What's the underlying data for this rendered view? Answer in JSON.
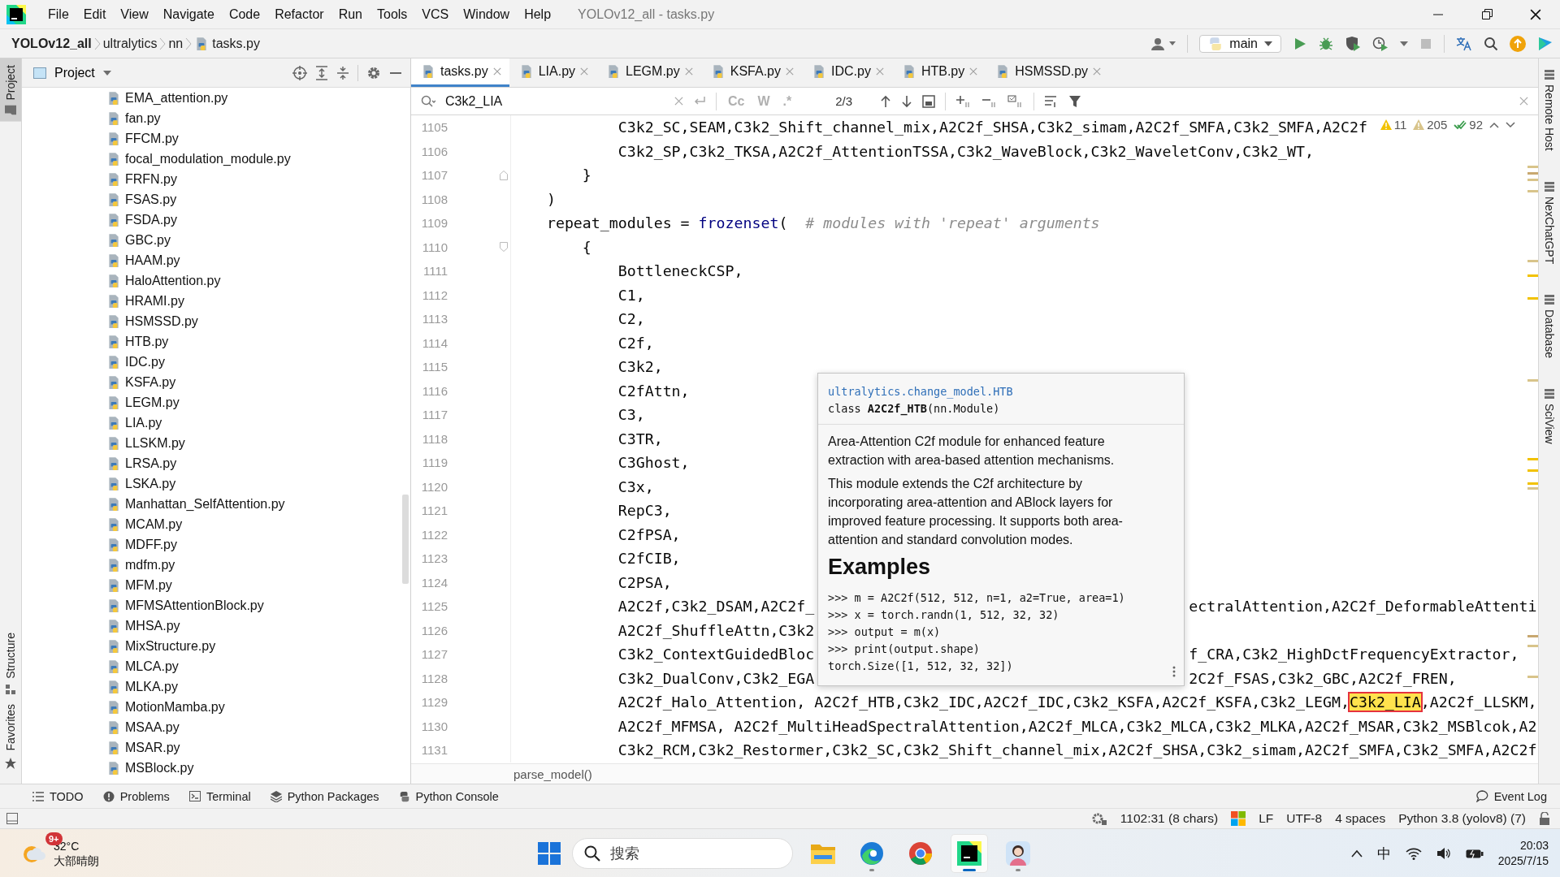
{
  "window": {
    "title": "YOLOv12_all - tasks.py"
  },
  "menu": [
    "File",
    "Edit",
    "View",
    "Navigate",
    "Code",
    "Refactor",
    "Run",
    "Tools",
    "VCS",
    "Window",
    "Help"
  ],
  "breadcrumb": [
    {
      "label": "YOLOv12_all",
      "kind": "project"
    },
    {
      "label": "ultralytics",
      "kind": "folder"
    },
    {
      "label": "nn",
      "kind": "folder"
    },
    {
      "label": "tasks.py",
      "kind": "file"
    }
  ],
  "toolbar": {
    "run_config": "main"
  },
  "left_tool_windows": [
    {
      "label": "Project",
      "selected": true
    },
    {
      "label": "Structure",
      "selected": false
    },
    {
      "label": "Favorites",
      "selected": false
    }
  ],
  "right_tool_windows": [
    "Remote Host",
    "NexChatGPT",
    "Database",
    "SciView"
  ],
  "project_panel": {
    "title": "Project",
    "files": [
      "EMA_attention.py",
      "fan.py",
      "FFCM.py",
      "focal_modulation_module.py",
      "FRFN.py",
      "FSAS.py",
      "FSDA.py",
      "GBC.py",
      "HAAM.py",
      "HaloAttention.py",
      "HRAMI.py",
      "HSMSSD.py",
      "HTB.py",
      "IDC.py",
      "KSFA.py",
      "LEGM.py",
      "LIA.py",
      "LLSKM.py",
      "LRSA.py",
      "LSKA.py",
      "Manhattan_SelfAttention.py",
      "MCAM.py",
      "MDFF.py",
      "mdfm.py",
      "MFM.py",
      "MFMSAttentionBlock.py",
      "MHSA.py",
      "MixStructure.py",
      "MLCA.py",
      "MLKA.py",
      "MotionMamba.py",
      "MSAA.py",
      "MSAR.py",
      "MSBlock.py"
    ]
  },
  "tabs": [
    {
      "label": "tasks.py",
      "selected": true
    },
    {
      "label": "LIA.py",
      "selected": false
    },
    {
      "label": "LEGM.py",
      "selected": false
    },
    {
      "label": "KSFA.py",
      "selected": false
    },
    {
      "label": "IDC.py",
      "selected": false
    },
    {
      "label": "HTB.py",
      "selected": false
    },
    {
      "label": "HSMSSD.py",
      "selected": false
    }
  ],
  "find_bar": {
    "value": "C3k2_LIA",
    "options": [
      {
        "label": "Cc",
        "on": false
      },
      {
        "label": "W",
        "on": false
      },
      {
        "label": ".*",
        "on": false
      }
    ],
    "counter": "2/3"
  },
  "inspections": {
    "warnings": "11",
    "weak_warnings": "205",
    "typos": "92"
  },
  "code_lines": [
    {
      "number": "1105",
      "segments": [
        {
          "kind": "code",
          "text": "            C3k2_SC,SEAM,C3k2_Shift_channel_mix,A2C2f_SHSA,C3k2_simam,A2C2f_SMFA,C3k2_SMFA,A2C2f"
        }
      ]
    },
    {
      "number": "1106",
      "segments": [
        {
          "kind": "code",
          "text": "            C3k2_SP,C3k2_TKSA,A2C2f_AttentionTSSA,C3k2_WaveBlock,C3k2_WaveletConv,C3k2_WT,"
        }
      ]
    },
    {
      "number": "1107",
      "fold_close": true,
      "segments": [
        {
          "kind": "code",
          "text": "        }"
        }
      ]
    },
    {
      "number": "1108",
      "segments": [
        {
          "kind": "code",
          "text": "    )"
        }
      ]
    },
    {
      "number": "1109",
      "segments": [
        {
          "kind": "code",
          "text": "    repeat_modules = "
        },
        {
          "kind": "builtin",
          "text": "frozenset"
        },
        {
          "kind": "code",
          "text": "(  "
        },
        {
          "kind": "comment",
          "text": "# modules with 'repeat' arguments"
        }
      ]
    },
    {
      "number": "1110",
      "fold_open": true,
      "segments": [
        {
          "kind": "code",
          "text": "        {"
        }
      ]
    },
    {
      "number": "1111",
      "segments": [
        {
          "kind": "code",
          "text": "            BottleneckCSP,"
        }
      ]
    },
    {
      "number": "1112",
      "segments": [
        {
          "kind": "code",
          "text": "            C1,"
        }
      ]
    },
    {
      "number": "1113",
      "segments": [
        {
          "kind": "code",
          "text": "            C2,"
        }
      ]
    },
    {
      "number": "1114",
      "segments": [
        {
          "kind": "code",
          "text": "            C2f,"
        }
      ]
    },
    {
      "number": "1115",
      "segments": [
        {
          "kind": "code",
          "text": "            C3k2,"
        }
      ]
    },
    {
      "number": "1116",
      "segments": [
        {
          "kind": "code",
          "text": "            C2fAttn,"
        }
      ]
    },
    {
      "number": "1117",
      "segments": [
        {
          "kind": "code",
          "text": "            C3,"
        }
      ]
    },
    {
      "number": "1118",
      "segments": [
        {
          "kind": "code",
          "text": "            C3TR,"
        }
      ]
    },
    {
      "number": "1119",
      "segments": [
        {
          "kind": "code",
          "text": "            C3Ghost,"
        }
      ]
    },
    {
      "number": "1120",
      "segments": [
        {
          "kind": "code",
          "text": "            C3x,"
        }
      ]
    },
    {
      "number": "1121",
      "segments": [
        {
          "kind": "code",
          "text": "            RepC3,"
        }
      ]
    },
    {
      "number": "1122",
      "segments": [
        {
          "kind": "code",
          "text": "            C2fPSA,"
        }
      ]
    },
    {
      "number": "1123",
      "segments": [
        {
          "kind": "code",
          "text": "            C2fCIB,"
        }
      ]
    },
    {
      "number": "1124",
      "segments": [
        {
          "kind": "code",
          "text": "            C2PSA,"
        }
      ]
    },
    {
      "number": "1125",
      "segments": [
        {
          "kind": "code",
          "text": "            A2C2f,C3k2_DSAM,A2C2f_"
        }
      ],
      "after_popup": "ectralAttention,A2C2f_DeformableAttenti"
    },
    {
      "number": "1126",
      "segments": [
        {
          "kind": "code",
          "text": "            A2C2f_ShuffleAttn,C3k2"
        }
      ]
    },
    {
      "number": "1127",
      "segments": [
        {
          "kind": "code",
          "text": "            C3k2_ContextGuidedBloc"
        }
      ],
      "after_popup": "f_CRA,C3k2_HighDctFrequencyExtractor,"
    },
    {
      "number": "1128",
      "segments": [
        {
          "kind": "code",
          "text": "            C3k2_DualConv,C3k2_EGA"
        }
      ],
      "after_popup": "2C2f_FSAS,C3k2_GBC,A2C2f_FREN,"
    },
    {
      "number": "1129",
      "segments": [
        {
          "kind": "code",
          "text": "            A2C2f_Halo_Attention, A2C2f_HTB,C3k2_IDC,A2C2f_IDC,C3k2_KSFA,A2C2f_KSFA,C3k2_LEGM,"
        },
        {
          "kind": "current_match",
          "text": "C3k2_LIA"
        },
        {
          "kind": "code",
          "text": ",A2C2f_LLSKM,"
        }
      ]
    },
    {
      "number": "1130",
      "segments": [
        {
          "kind": "code",
          "text": "            A2C2f_MFMSA, A2C2f_MultiHeadSpectralAttention,A2C2f_MLCA,C3k2_MLCA,C3k2_MLKA,A2C2f_MSAR,C3k2_MSBlcok,A2"
        }
      ]
    },
    {
      "number": "1131",
      "segments": [
        {
          "kind": "code",
          "text": "            C3k2_RCM,C3k2_Restormer,C3k2_SC,C3k2_Shift_channel_mix,A2C2f_SHSA,C3k2_simam,A2C2f_SMFA,C3k2_SMFA,A2C2f"
        }
      ]
    }
  ],
  "doc_popup": {
    "reference": "ultralytics.change_model.HTB",
    "signature": "class **A2C2f_HTB**(nn.Module)",
    "paragraphs": [
      "Area-Attention C2f module for enhanced feature extraction with area-based attention mechanisms.",
      "This module extends the C2f architecture by incorporating area-attention and ABlock layers for improved feature processing. It supports both area-attention and standard convolution modes."
    ],
    "heading": "Examples",
    "example": [
      ">>> m = A2C2f(512, 512, n=1, a2=True, area=1)",
      ">>> x = torch.randn(1, 512, 32, 32)",
      ">>> output = m(x)",
      ">>> print(output.shape)",
      "torch.Size([1, 512, 32, 32])"
    ]
  },
  "editor_breadcrumb": "parse_model()",
  "bottom_tools": [
    {
      "label": "TODO",
      "kind": "todo"
    },
    {
      "label": "Problems",
      "kind": "problems"
    },
    {
      "label": "Terminal",
      "kind": "terminal"
    },
    {
      "label": "Python Packages",
      "kind": "packages"
    },
    {
      "label": "Python Console",
      "kind": "console"
    }
  ],
  "event_log": "Event Log",
  "status_bar": {
    "position": "1102:31 (8 chars)",
    "line_separator": "LF",
    "encoding": "UTF-8",
    "indent": "4 spaces",
    "interpreter": "Python 3.8 (yolov8) (7)"
  },
  "taskbar": {
    "weather": {
      "badge": "9+",
      "temperature": "32°C",
      "condition": "大部晴朗"
    },
    "search_placeholder": "搜索",
    "apps": [
      {
        "kind": "files",
        "running": false,
        "selected": false
      },
      {
        "kind": "edge",
        "running": true,
        "selected": false
      },
      {
        "kind": "chrome",
        "running": false,
        "selected": false
      },
      {
        "kind": "pycharm",
        "running": true,
        "selected": true
      },
      {
        "kind": "avatar",
        "running": true,
        "selected": false
      }
    ],
    "input_method": "中",
    "time": "20:03",
    "date": "2025/7/15"
  }
}
